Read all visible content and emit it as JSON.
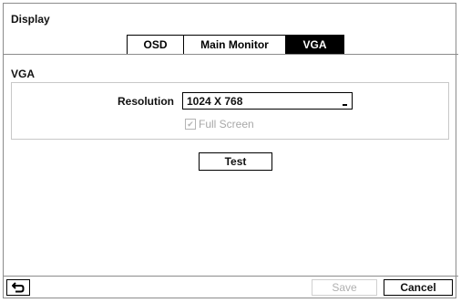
{
  "window": {
    "title": "Display"
  },
  "tabs": [
    {
      "label": "OSD",
      "active": false
    },
    {
      "label": "Main Monitor",
      "active": false
    },
    {
      "label": "VGA",
      "active": true
    }
  ],
  "vga": {
    "section_label": "VGA",
    "resolution_label": "Resolution",
    "resolution_value": "1024 X 768",
    "full_screen_label": "Full Screen",
    "full_screen_checked": true,
    "full_screen_enabled": false,
    "test_label": "Test"
  },
  "footer": {
    "back_icon": "return-arrow-icon",
    "save_label": "Save",
    "save_enabled": false,
    "cancel_label": "Cancel"
  }
}
